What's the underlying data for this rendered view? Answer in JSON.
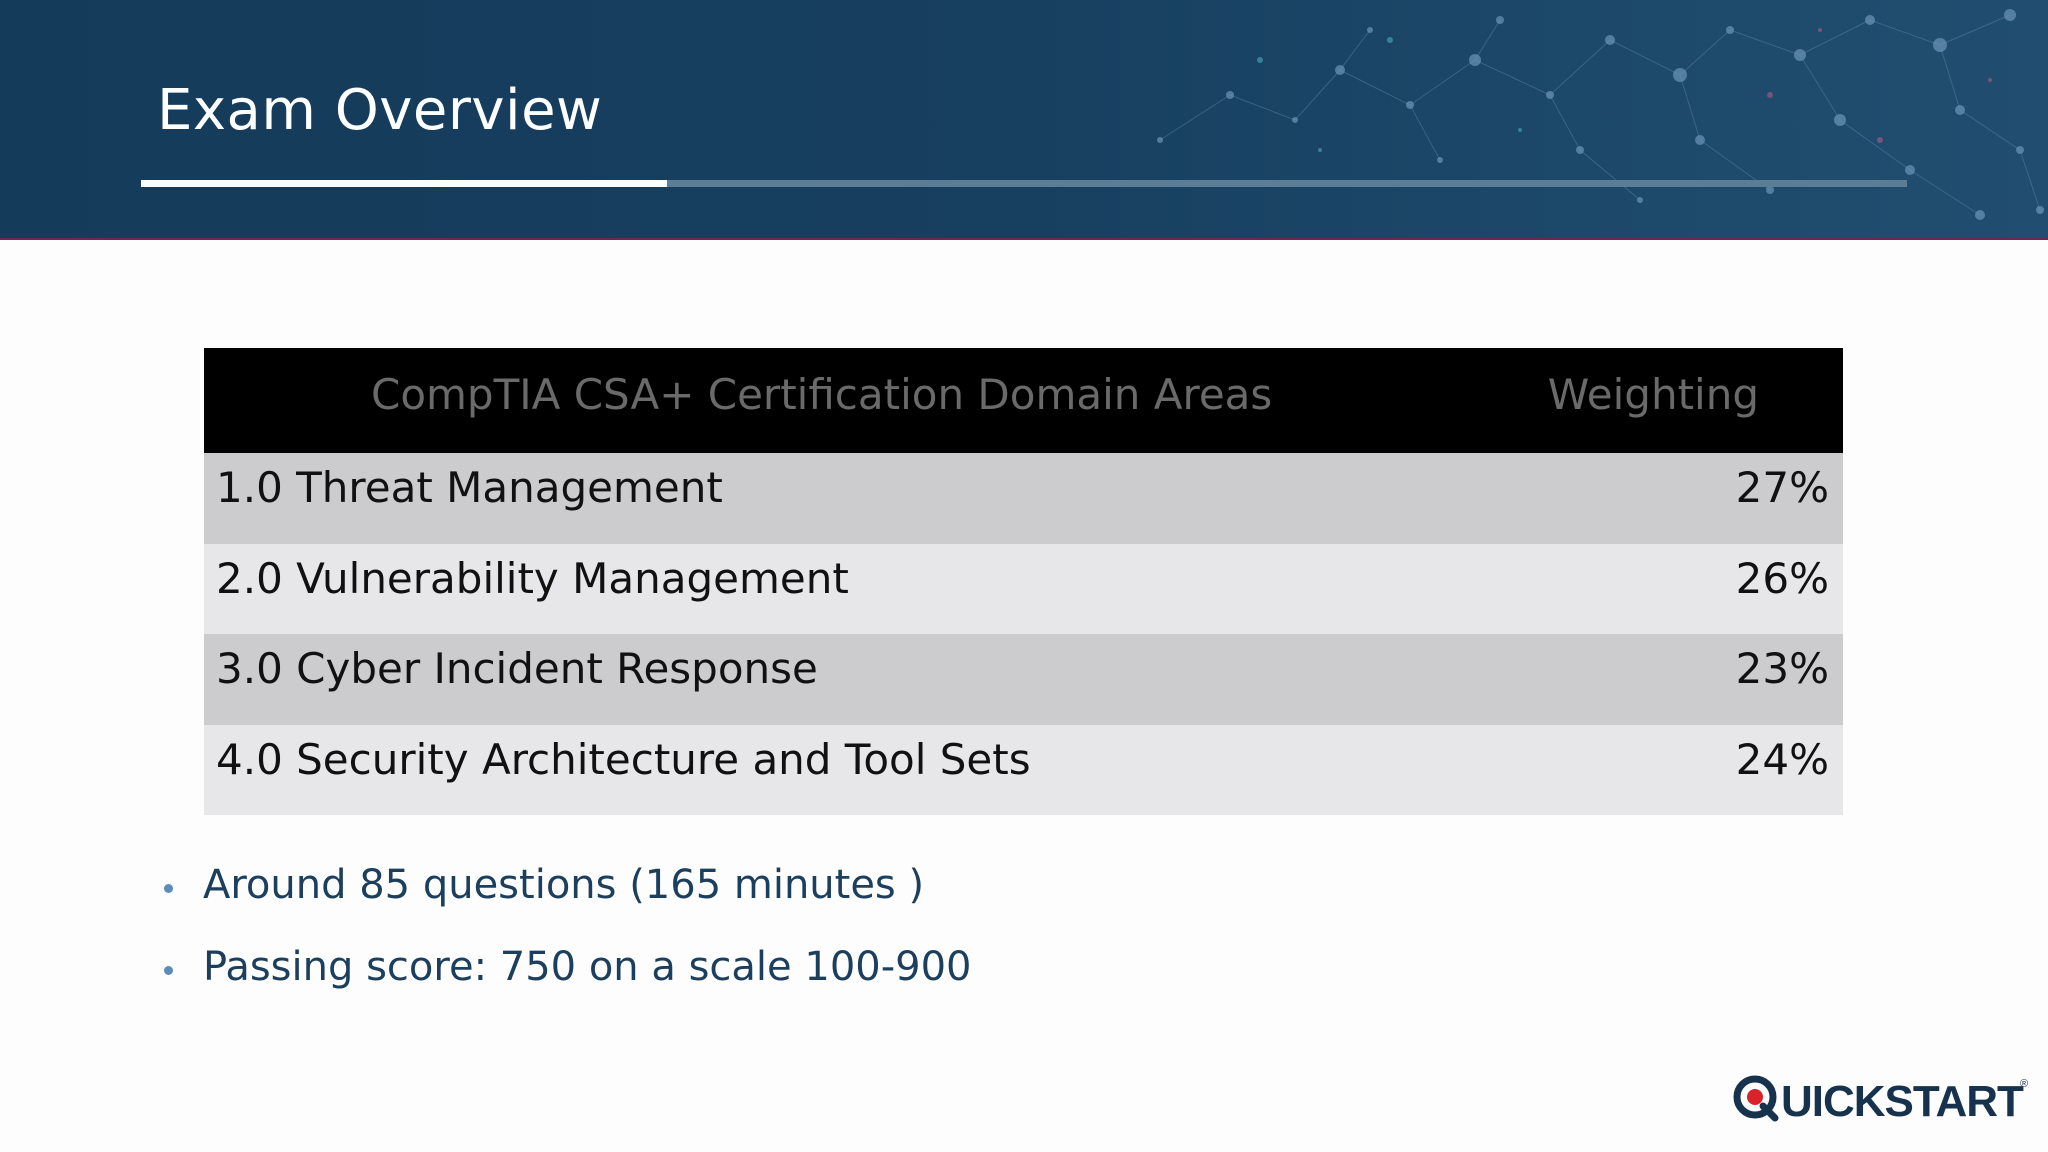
{
  "slide": {
    "title": "Exam Overview",
    "title_rule_progress_fraction": 0.298
  },
  "table": {
    "header": {
      "domain": "CompTIA CSA+ Certification Domain Areas",
      "weighting": "Weighting"
    },
    "rows": [
      {
        "domain": "1.0 Threat Management",
        "weighting": "27%"
      },
      {
        "domain": "2.0 Vulnerability Management",
        "weighting": "26%"
      },
      {
        "domain": "3.0 Cyber Incident Response",
        "weighting": "23%"
      },
      {
        "domain": "4.0 Security Architecture and Tool Sets",
        "weighting": "24%"
      }
    ]
  },
  "bullets": [
    "Around 85 questions (165 minutes )",
    "Passing score: 750 on a scale 100-900"
  ],
  "logo": {
    "text": "UICKSTART",
    "full_name": "QUICKSTART",
    "registered_mark": "®"
  },
  "colors": {
    "header_bg": "#153b5a",
    "accent_text": "#1c3f5e",
    "bullet_dot": "#5b8db8",
    "logo_red": "#d8232a"
  }
}
